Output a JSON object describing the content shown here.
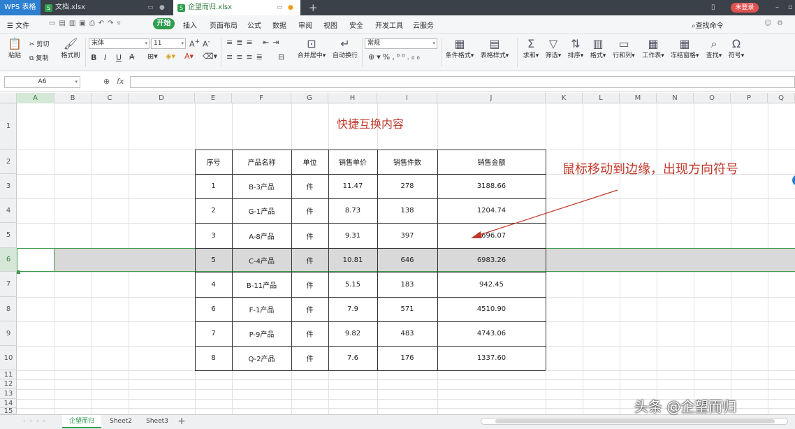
{
  "titlebar": {
    "app_tab": "WPS 表格",
    "tabs": [
      "文档.xlsx",
      "企望而归.xlsx"
    ],
    "login": "未登录"
  },
  "menubar": {
    "file": "文件",
    "start": "开始",
    "items": [
      "插入",
      "页面布局",
      "公式",
      "数据",
      "审阅",
      "视图",
      "安全",
      "开发工具",
      "云服务"
    ],
    "find": "查找命令"
  },
  "ribbon": {
    "paste": "粘贴",
    "cut": "剪切",
    "copy": "复制",
    "format_painter": "格式刷",
    "font_name": "宋体",
    "font_size": "11",
    "merge_center": "合并居中",
    "wrap_text": "自动换行",
    "number_format": "常规",
    "conditional_format": "条件格式",
    "table_style": "表格样式",
    "sum": "求和",
    "filter": "筛选",
    "sort": "排序",
    "format": "格式",
    "row_col": "行和列",
    "worksheet": "工作表",
    "freeze": "冻结窗格",
    "find": "查找",
    "symbol": "符号"
  },
  "formula_bar": {
    "name_box": "A6",
    "fx": "fx"
  },
  "columns": [
    "A",
    "B",
    "C",
    "D",
    "E",
    "F",
    "G",
    "H",
    "I",
    "J",
    "K",
    "L",
    "M",
    "N",
    "O",
    "P",
    "Q"
  ],
  "rows": [
    "1",
    "2",
    "3",
    "4",
    "5",
    "6",
    "7",
    "8",
    "9",
    "10",
    "11",
    "12",
    "13",
    "14",
    "15"
  ],
  "sheet": {
    "title": "快捷互换内容",
    "headers": [
      "序号",
      "产品名称",
      "单位",
      "销售单价",
      "销售件数",
      "销售金额"
    ],
    "data_rows": [
      [
        "1",
        "B-3产品",
        "件",
        "11.47",
        "278",
        "3188.66"
      ],
      [
        "2",
        "G-1产品",
        "件",
        "8.73",
        "138",
        "1204.74"
      ],
      [
        "3",
        "A-8产品",
        "件",
        "9.31",
        "397",
        "3696.07"
      ],
      [
        "5",
        "C-4产品",
        "件",
        "10.81",
        "646",
        "6983.26"
      ],
      [
        "4",
        "B-11产品",
        "件",
        "5.15",
        "183",
        "942.45"
      ],
      [
        "6",
        "F-1产品",
        "件",
        "7.9",
        "571",
        "4510.90"
      ],
      [
        "7",
        "P-9产品",
        "件",
        "9.82",
        "483",
        "4743.06"
      ],
      [
        "8",
        "Q-2产品",
        "件",
        "7.6",
        "176",
        "1337.60"
      ]
    ],
    "annotation": "鼠标移动到边缘，出现方向符号"
  },
  "sheet_tabs": [
    "企望而归",
    "Sheet2",
    "Sheet3"
  ],
  "watermark": "头条 @企望而归",
  "colors": {
    "accent": "#2e9e4f",
    "selection": "#3f9b4f",
    "annotation": "#c0392b",
    "login": "#e05252"
  }
}
